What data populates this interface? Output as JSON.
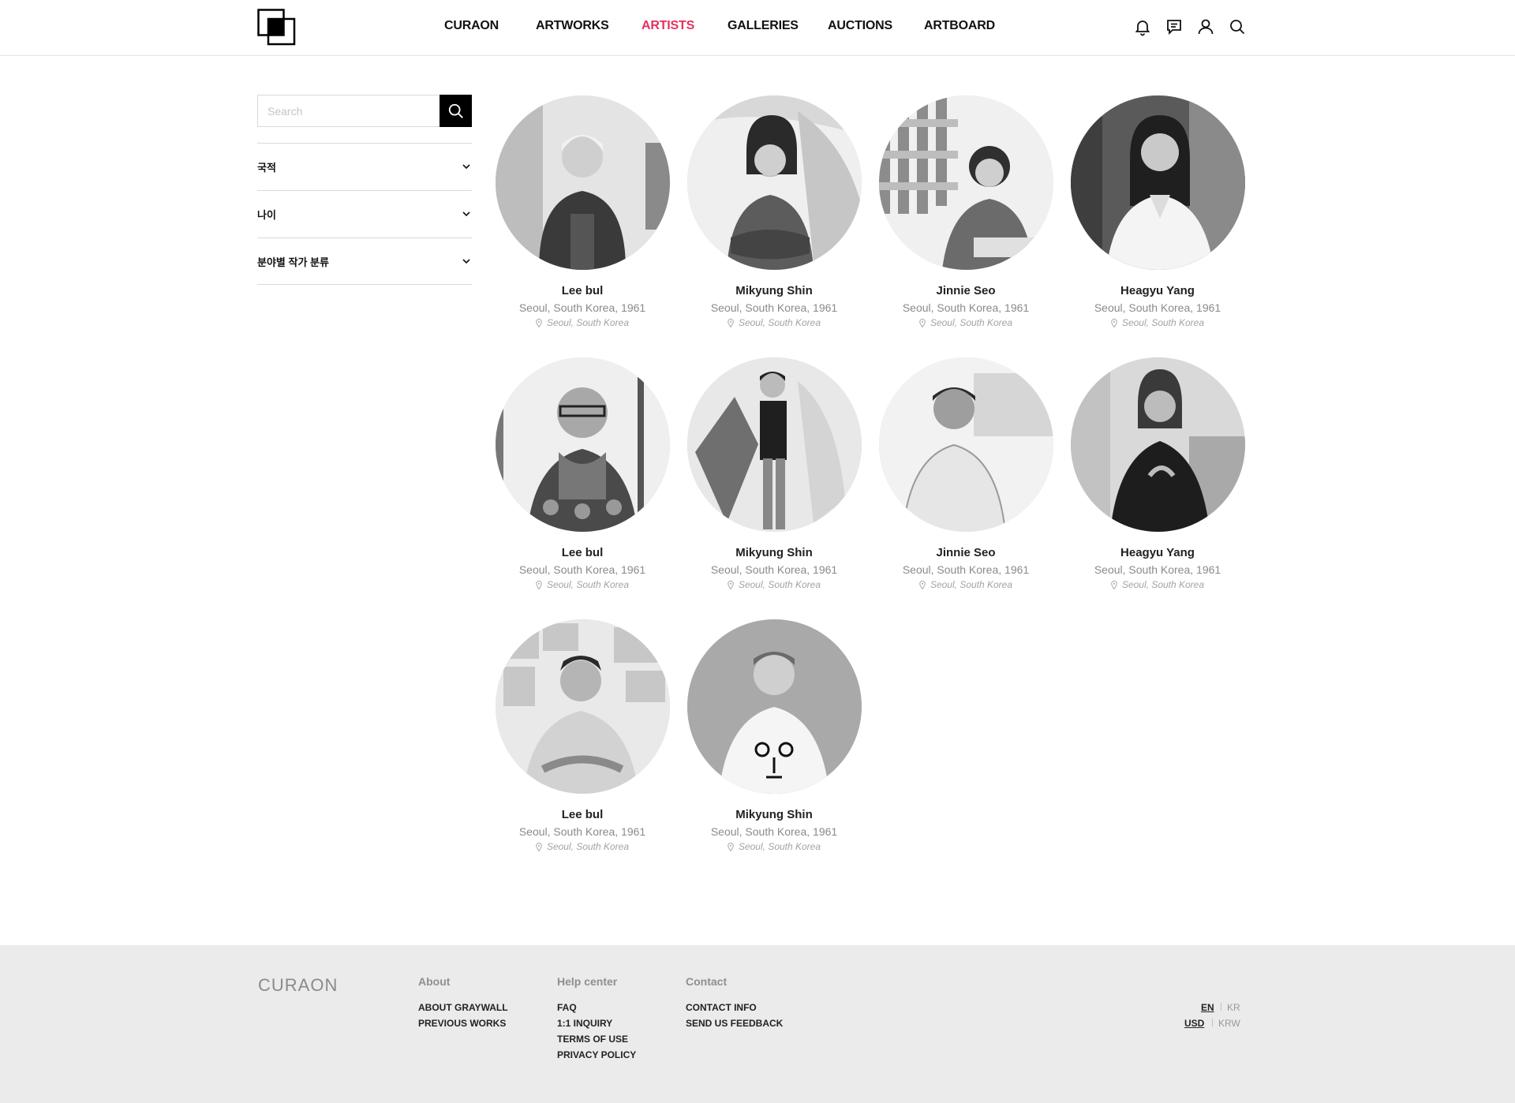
{
  "header": {
    "nav": [
      {
        "label": "CURAON",
        "active": false
      },
      {
        "label": "ARTWORKS",
        "active": false
      },
      {
        "label": "ARTISTS",
        "active": true
      },
      {
        "label": "GALLERIES",
        "active": false
      },
      {
        "label": "AUCTIONS",
        "active": false
      },
      {
        "label": "ARTBOARD",
        "active": false
      }
    ],
    "icons": [
      "bell-icon",
      "message-icon",
      "user-icon",
      "search-icon"
    ],
    "accent_color": "#e8305f"
  },
  "sidebar": {
    "search": {
      "placeholder": "Search",
      "value": ""
    },
    "filters": [
      {
        "label": "국적"
      },
      {
        "label": "나이"
      },
      {
        "label": "분야별 작가 분류"
      }
    ]
  },
  "artists": [
    {
      "name": "Lee bul",
      "info": "Seoul, South Korea, 1961",
      "location": "Seoul, South Korea"
    },
    {
      "name": "Mikyung Shin",
      "info": "Seoul, South Korea, 1961",
      "location": "Seoul, South Korea"
    },
    {
      "name": "Jinnie Seo",
      "info": "Seoul, South Korea, 1961",
      "location": "Seoul, South Korea"
    },
    {
      "name": "Heagyu Yang",
      "info": "Seoul, South Korea, 1961",
      "location": "Seoul, South Korea"
    },
    {
      "name": "Lee bul",
      "info": "Seoul, South Korea, 1961",
      "location": "Seoul, South Korea"
    },
    {
      "name": "Mikyung Shin",
      "info": "Seoul, South Korea, 1961",
      "location": "Seoul, South Korea"
    },
    {
      "name": "Jinnie Seo",
      "info": "Seoul, South Korea, 1961",
      "location": "Seoul, South Korea"
    },
    {
      "name": "Heagyu Yang",
      "info": "Seoul, South Korea, 1961",
      "location": "Seoul, South Korea"
    },
    {
      "name": "Lee bul",
      "info": "Seoul, South Korea, 1961",
      "location": "Seoul, South Korea"
    },
    {
      "name": "Mikyung Shin",
      "info": "Seoul, South Korea, 1961",
      "location": "Seoul, South Korea"
    }
  ],
  "footer": {
    "brand": "CURAON",
    "about": {
      "title": "About",
      "links": [
        "ABOUT GRAYWALL",
        "PREVIOUS WORKS"
      ]
    },
    "help": {
      "title": "Help center",
      "links": [
        "FAQ",
        "1:1 INQUIRY",
        "TERMS OF USE",
        "PRIVACY POLICY"
      ]
    },
    "contact": {
      "title": "Contact",
      "links": [
        "CONTACT INFO",
        "SEND US FEEDBACK"
      ]
    },
    "language": {
      "selected": "EN",
      "other": "KR"
    },
    "currency": {
      "selected": "USD",
      "other": "KRW"
    }
  }
}
